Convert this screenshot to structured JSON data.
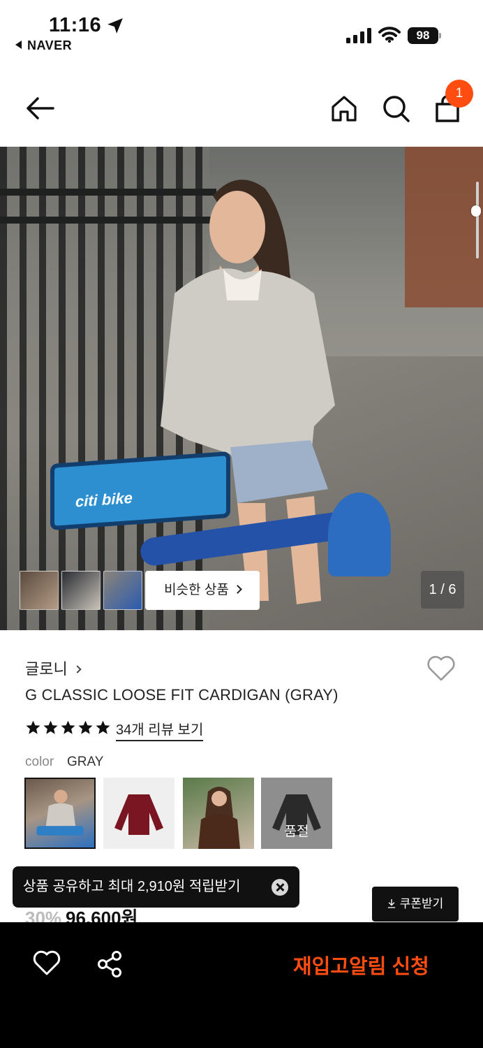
{
  "status_bar": {
    "time": "11:16",
    "back_app": "NAVER",
    "battery": "98"
  },
  "nav": {
    "cart_count": "1",
    "icons": [
      "back-arrow-icon",
      "home-icon",
      "search-icon",
      "shopping-bag-icon"
    ]
  },
  "gallery": {
    "similar_button": "비슷한 상품",
    "pager": "1 / 6",
    "basket_brand": "citi bike",
    "thumbnail_count": 3
  },
  "product": {
    "brand": "글로니",
    "name": "G CLASSIC LOOSE FIT CARDIGAN (GRAY)",
    "stars": 5,
    "review_link": "34개 리뷰 보기",
    "color_label": "color",
    "color_value": "GRAY",
    "swatches": [
      {
        "name": "gray",
        "selected": true
      },
      {
        "name": "burgundy",
        "selected": false
      },
      {
        "name": "brown",
        "selected": false
      },
      {
        "name": "black",
        "selected": false,
        "status": "품절"
      }
    ]
  },
  "price": {
    "discount": "30%",
    "amount": "96,600원"
  },
  "toast": {
    "text": "상품 공유하고 최대 2,910원 적립받기"
  },
  "coupon": {
    "label": "쿠폰받기"
  },
  "bottom_bar": {
    "restock_label": "재입고알림 신청"
  },
  "colors": {
    "accent": "#ff4d12",
    "dark": "#111111"
  }
}
